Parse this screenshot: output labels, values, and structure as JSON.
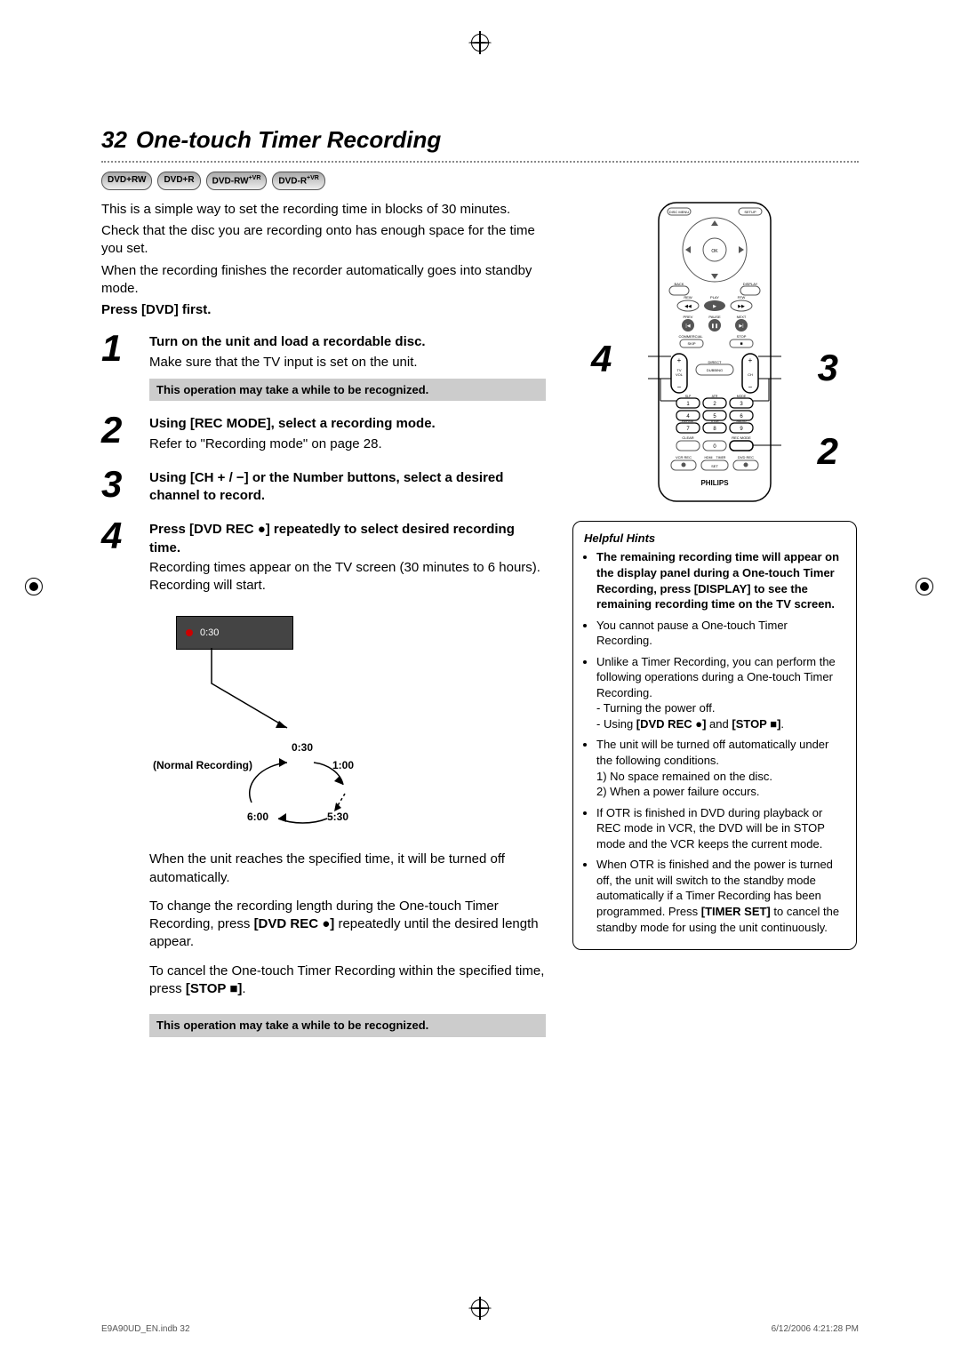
{
  "page": {
    "number": "32",
    "title": "One-touch Timer Recording"
  },
  "badges": [
    "DVD+RW",
    "DVD+R",
    "DVD-RW",
    "DVD-R"
  ],
  "intro": {
    "p1": "This is a simple way to set the recording time in blocks of 30 minutes.",
    "p2": "Check that the disc you are recording onto has enough space for the time you set.",
    "p3": "When the recording finishes the recorder automatically goes into standby mode.",
    "press": "Press [DVD] first."
  },
  "steps": [
    {
      "num": "1",
      "head": "Turn on the unit and load a recordable disc.",
      "body": "Make sure that the TV input is set on the unit.",
      "note": "This operation may take a while to be recognized."
    },
    {
      "num": "2",
      "head": "Using [REC MODE], select a recording mode.",
      "body": "Refer to \"Recording mode\" on page 28."
    },
    {
      "num": "3",
      "head": "Using [CH + / −] or the Number buttons, select a desired channel to record."
    },
    {
      "num": "4",
      "head": "Press [DVD REC ●] repeatedly to select desired recording time.",
      "body": "Recording times appear on the TV screen (30 minutes to 6 hours). Recording will start."
    }
  ],
  "diagram": {
    "osd_time": "0:30",
    "top_label": "0:30",
    "normal": "(Normal Recording)",
    "r100": "1:00",
    "l600": "6:00",
    "r530": "5:30"
  },
  "followups": {
    "p1": "When the unit reaches the specified time, it will be turned off automatically.",
    "p2_a": "To change the recording length during the One-touch Timer Recording, press ",
    "p2_b": "[DVD REC ●]",
    "p2_c": " repeatedly until the desired length appear.",
    "p3_a": "To cancel the One-touch Timer Recording within the specified time, press ",
    "p3_b": "[STOP ■]",
    "p3_c": ".",
    "note": "This operation may take a while to be recognized."
  },
  "callouts": {
    "c4": "4",
    "c3": "3",
    "c2": "2"
  },
  "remote": {
    "brand": "PHILIPS"
  },
  "hints": {
    "title": "Helpful Hints",
    "b1": "The remaining recording time will appear on the display panel during a One-touch Timer Recording, press [DISPLAY] to see the remaining recording time on the TV screen.",
    "b2": "You cannot pause a One-touch Timer Recording.",
    "b3_lead": "Unlike a Timer Recording, you can perform the following operations during a One-touch Timer Recording.",
    "b3_s1": "- Turning the power off.",
    "b3_s2a": "- Using ",
    "b3_s2b": "[DVD REC ●]",
    "b3_s2c": " and ",
    "b3_s2d": "[STOP ■]",
    "b3_s2e": ".",
    "b4": "The unit will be turned off automatically under the following conditions.",
    "b4_1": "1) No space remained on the disc.",
    "b4_2": "2) When a power failure occurs.",
    "b5": "If OTR is finished in DVD during playback or REC mode in VCR, the DVD will be in STOP mode and the VCR keeps the current mode.",
    "b6_a": "When OTR is finished and the power is turned off, the unit will switch to the standby mode automatically if a Timer Recording has been programmed. Press ",
    "b6_b": "[TIMER SET]",
    "b6_c": " to cancel the standby mode for using the unit continuously."
  },
  "footer": {
    "left": "E9A90UD_EN.indb   32",
    "right": "6/12/2006   4:21:28 PM"
  }
}
